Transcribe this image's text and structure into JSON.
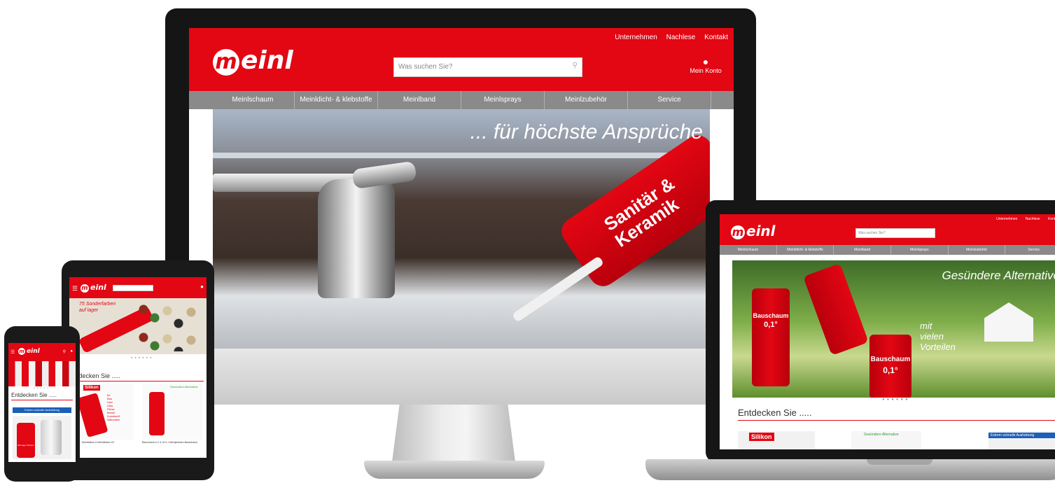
{
  "brand": {
    "logo_text": "meinl",
    "color_red": "#e30613",
    "color_nav": "#8a8a8a"
  },
  "top_links": [
    "Unternehmen",
    "Nachlese",
    "Kontakt"
  ],
  "search": {
    "placeholder": "Was suchen Sie?",
    "icon": "search-icon"
  },
  "account": {
    "label": "Mein Konto",
    "icon": "user-icon"
  },
  "nav": [
    "Meinlschaum",
    "Meinldicht- & klebstoffe",
    "Meinlband",
    "Meinlsprays",
    "Meinlzubehör",
    "Service"
  ],
  "desktop_hero": {
    "headline": "... für höchste Ansprüche",
    "tube_text_1": "Sanitär &",
    "tube_text_2": "Keramik"
  },
  "laptop_hero": {
    "headline": "Gesündere Alternative",
    "sub_1": "mit",
    "sub_2": "vielen",
    "sub_3": "Vorteilen",
    "can_label_1": "Bauschaum",
    "can_label_2": "0,1°",
    "can_label_3": "Bauschaum",
    "can_label_4": "0,1°"
  },
  "section": {
    "title": "Entdecken Sie .....",
    "laptop_badge_1": "Silikon",
    "laptop_badge_2": "Gesündere Alternative",
    "laptop_badge_3": "Extrem schnelle Aushärtung"
  },
  "tablet": {
    "hero_text_1": "75 Sonderfarben",
    "hero_text_2": "auf lager",
    "section_title": "ntdecken Sie .....",
    "product_badge": "Silikon",
    "product_words": [
      "für",
      "Bau",
      "Holz",
      "Glas",
      "Fliese",
      "Metall",
      "Kunststoff",
      "Naturstein"
    ],
    "caption_1": "Meinlsilikon & Meinlsilikon-XX",
    "caption_2": "Bauschaum 0,1 & Gr.0,1 Meinlpistolen-Bauschaum",
    "green_label": "Gesündere Alternative"
  },
  "phone": {
    "section_title": "Entdecken Sie .....",
    "banner": "Extrem schnelle Aushärtung",
    "can_label": "Montage-Schaum"
  }
}
